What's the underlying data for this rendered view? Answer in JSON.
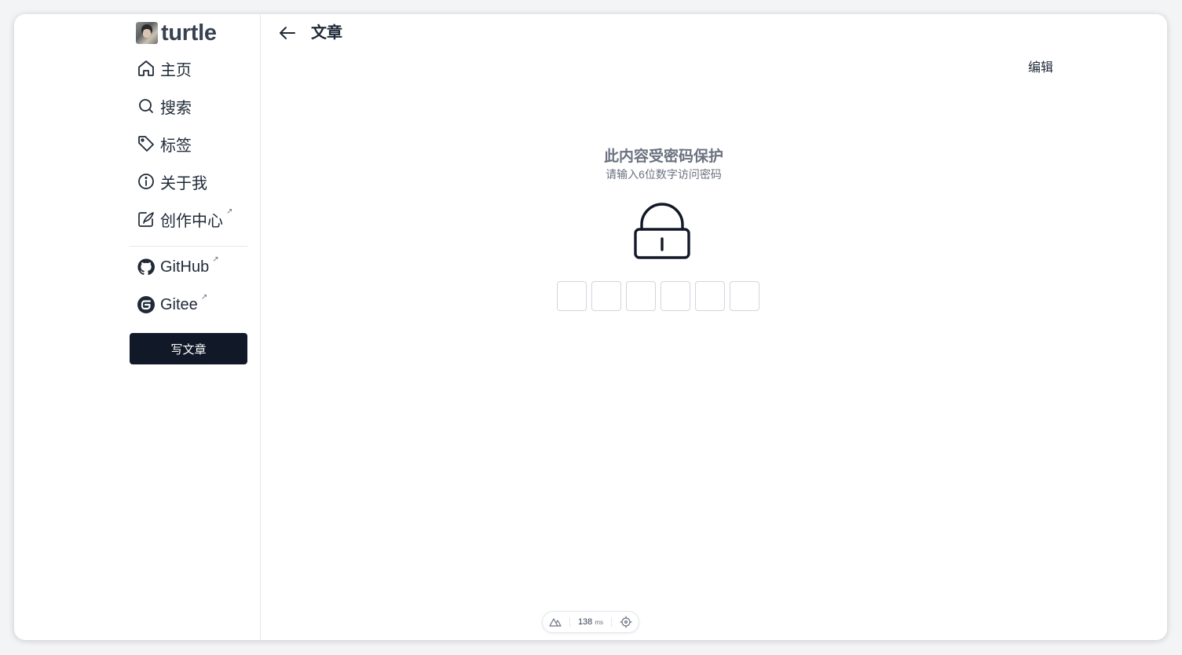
{
  "sidebar": {
    "brand": "turtle",
    "nav": [
      {
        "label": "主页",
        "icon": "home-icon"
      },
      {
        "label": "搜索",
        "icon": "search-icon"
      },
      {
        "label": "标签",
        "icon": "tag-icon"
      },
      {
        "label": "关于我",
        "icon": "info-icon"
      },
      {
        "label": "创作中心",
        "icon": "edit-icon",
        "external": true
      }
    ],
    "links": [
      {
        "label": "GitHub",
        "icon": "github-icon",
        "external": true
      },
      {
        "label": "Gitee",
        "icon": "gitee-icon",
        "external": true
      }
    ],
    "external_mark": "↗",
    "write_button": "写文章"
  },
  "header": {
    "back_icon": "arrow-left-icon",
    "title": "文章",
    "edit_label": "编辑"
  },
  "lock": {
    "title": "此内容受密码保护",
    "subtitle": "请输入6位数字访问密码",
    "icon": "lock-icon",
    "pin_length": 6,
    "pin_values": [
      "",
      "",
      "",
      "",
      "",
      ""
    ]
  },
  "devtools": {
    "logo_icon": "nuxt-icon",
    "timing_value": "138",
    "timing_unit": "ms",
    "inspect_icon": "crosshair-icon"
  },
  "colors": {
    "primary_button": "#111827",
    "muted_text": "#6b7280",
    "border": "#e5e7eb"
  }
}
